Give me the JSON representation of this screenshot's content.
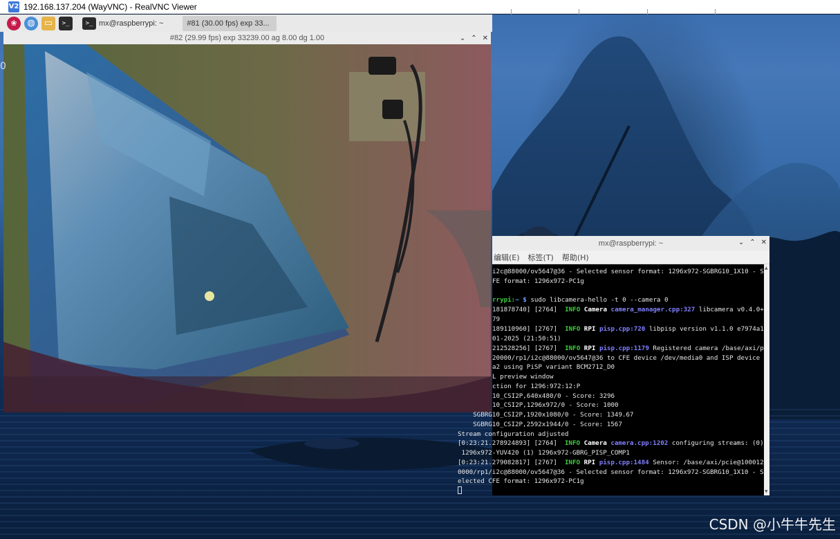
{
  "vnc": {
    "title": "192.168.137.204 (WayVNC) - RealVNC Viewer",
    "logo": "V2"
  },
  "taskbar": {
    "launchers": [
      {
        "icon": "raspberry-pi-menu-icon"
      },
      {
        "icon": "web-browser-icon"
      },
      {
        "icon": "file-manager-icon"
      },
      {
        "icon": "terminal-icon"
      }
    ],
    "tasks": [
      {
        "label": "mx@raspberrypi: ~",
        "icon": "terminal-icon"
      },
      {
        "label": "#81 (30.00 fps) exp 33...",
        "active": true
      }
    ]
  },
  "camera_window": {
    "title": "#82 (29.99 fps) exp 33239.00 ag 8.00 dg 1.00",
    "controls": [
      "⌄",
      "⌃",
      "✕"
    ]
  },
  "terminal": {
    "title": "mx@raspberrypi: ~",
    "controls": [
      "⌄",
      "⌃",
      "✕"
    ],
    "menu": [
      "编辑(E)",
      "标签(T)",
      "帮助(H)"
    ],
    "prompt_user": "rrypi:",
    "prompt_rest": "~ $ ",
    "command": "sudo libcamera-hello -t 0 --camera 0",
    "lines": [
      "i2c@88000/ov5647@36 - Selected sensor format: 1296x972-SGBRG10_1X10 - S",
      "FE format: 1296x972-PC1g",
      "",
      "",
      "181878740] [2764]  ",
      "79",
      "189110960] [2767]  ",
      "01-2025 (21:50:51)",
      "212528256] [2767]  ",
      "20000/rp1/i2c@88000/ov5647@36 to CFE device /dev/media0 and ISP device",
      "a2 using PiSP variant BCM2712_D0",
      "L preview window",
      "ction for 1296:972:12:P",
      "10_CSI2P,640x480/0 - Score: 3296",
      "10_CSI2P,1296x972/0 - Score: 1000",
      "    SGBRG10_CSI2P,1920x1080/0 - Score: 1349.67",
      "    SGBRG10_CSI2P,2592x1944/0 - Score: 1567",
      "Stream configuration adjusted",
      "[0:23:21.278924893] [2764]  ",
      " 1296x972-YUV420 (1) 1296x972-GBRG_PISP_COMP1",
      "[0:23:21.279082817] [2767]  ",
      "0000/rp1/i2c@88000/ov5647@36 - Selected sensor format: 1296x972-SGBRG10_1X10 - S",
      "elected CFE format: 1296x972-PC1g"
    ],
    "log": {
      "l4": {
        "level": "INFO",
        "cat": "Camera",
        "src": "camera_manager.cpp:327",
        "msg": " libcamera v0.4.0+"
      },
      "l6": {
        "level": "INFO",
        "cat": "RPI",
        "src": "pisp.cpp:720",
        "msg": " libpisp version v1.1.0 e7974a1"
      },
      "l8": {
        "level": "INFO",
        "cat": "RPI",
        "src": "pisp.cpp:1179",
        "msg": " Registered camera /base/axi/p"
      },
      "l18": {
        "level": "INFO",
        "cat": "Camera",
        "src": "camera.cpp:1202",
        "msg": " configuring streams: (0)"
      },
      "l20": {
        "level": "INFO",
        "cat": "RPI",
        "src": "pisp.cpp:1484",
        "msg": " Sensor: /base/axi/pcie@100012"
      }
    }
  },
  "desktop": {
    "watermark": "CSDN @小牛牛先生",
    "left_artifact": "0"
  },
  "colors": {
    "prompt_green": "#3cd13c",
    "info_green": "#3cd13c",
    "source_blue": "#8080ff",
    "terminal_bg": "#000000",
    "titlebar_bg": "#ebebeb"
  }
}
